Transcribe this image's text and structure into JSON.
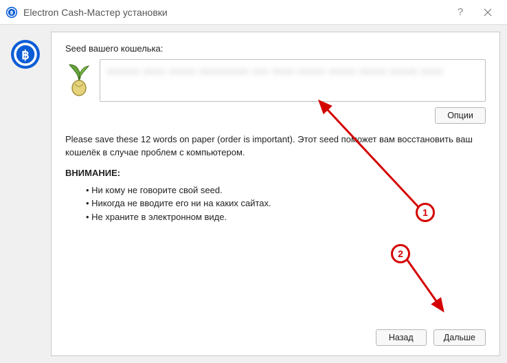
{
  "titlebar": {
    "app_name": "Electron Cash",
    "separator": "  -  ",
    "subtitle": "Мастер установки"
  },
  "seed": {
    "label": "Seed вашего кошелька:",
    "placeholder_blur": "xxxxxx xxxx xxxxx xxxxxxxxx xxx xxxx xxxxx xxxxx xxxxx xxxxx xxxx"
  },
  "buttons": {
    "options": "Опции",
    "back": "Назад",
    "next": "Дальше"
  },
  "help": {
    "text": "Please save these 12 words on paper (order is important). Этот seed поможет вам восстановить ваш кошелёк в случае проблем с компьютером."
  },
  "attention": {
    "label": "ВНИМАНИЕ:",
    "items": [
      "Ни кому не говорите свой seed.",
      "Никогда не вводите его ни на каких сайтах.",
      "Не храните в электронном виде."
    ]
  },
  "annotations": {
    "marker1": "1",
    "marker2": "2"
  }
}
